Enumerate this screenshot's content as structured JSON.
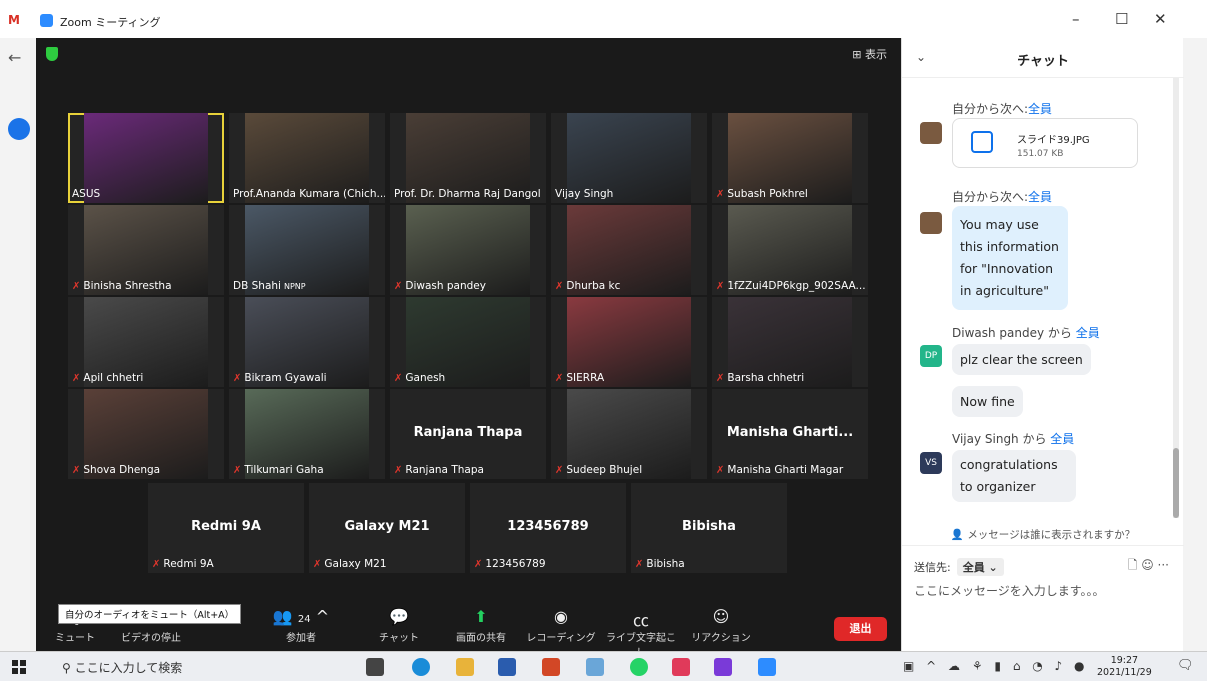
{
  "window": {
    "title": "Zoom ミーティング",
    "gmail": "M"
  },
  "video": {
    "view_label": "⊞ 表示",
    "participants": [
      {
        "name": "ASUS",
        "muted": false,
        "active": true,
        "bg": "#6b2a7a"
      },
      {
        "name": "Prof.Ananda Kumara (Chich...",
        "muted": false,
        "bg": "#5a4a3a"
      },
      {
        "name": "Prof. Dr. Dharma Raj Dangol",
        "muted": false,
        "bg": "#4a3e36"
      },
      {
        "name": "Vijay Singh",
        "muted": false,
        "bg": "#3a4450"
      },
      {
        "name": "Subash Pokhrel",
        "muted": true,
        "bg": "#6a5040"
      },
      {
        "name": "Binisha Shrestha",
        "muted": true,
        "bg": "#5b5248"
      },
      {
        "name": "DB Shahi",
        "sub": "NPNP",
        "muted": false,
        "bg": "#4b5866"
      },
      {
        "name": "Diwash pandey",
        "muted": true,
        "bg": "#5a6050"
      },
      {
        "name": "Dhurba kc",
        "muted": true,
        "bg": "#6b3a3a"
      },
      {
        "name": "1fZZui4DP6kgp_902SAA...",
        "muted": true,
        "bg": "#5a5a50"
      },
      {
        "name": "Apil chhetri",
        "muted": true,
        "bg": "#4a4a4a"
      },
      {
        "name": "Bikram Gyawali",
        "muted": true,
        "bg": "#4a4e58"
      },
      {
        "name": "Ganesh",
        "muted": true,
        "bg": "#2e3a30"
      },
      {
        "name": "SIERRA",
        "muted": true,
        "bg": "#8a3a40"
      },
      {
        "name": "Barsha chhetri",
        "muted": true,
        "bg": "#3a3238"
      },
      {
        "name": "Shova Dhenga",
        "muted": true,
        "bg": "#5a4038"
      },
      {
        "name": "Tilkumari Gaha",
        "muted": true,
        "bg": "#586a58"
      },
      {
        "name": "Ranjana Thapa",
        "muted": true,
        "big": "Ranjana Thapa"
      },
      {
        "name": "Sudeep Bhujel",
        "muted": true,
        "bg": "#4a4a4a"
      },
      {
        "name": "Manisha Gharti Magar",
        "muted": true,
        "big": "Manisha  Gharti..."
      },
      {
        "name": "Redmi 9A",
        "muted": true,
        "big": "Redmi 9A"
      },
      {
        "name": "Galaxy M21",
        "muted": true,
        "big": "Galaxy M21"
      },
      {
        "name": "123456789",
        "muted": true,
        "big": "123456789"
      },
      {
        "name": "Bibisha",
        "muted": true,
        "big": "Bibisha"
      }
    ]
  },
  "toolbar": {
    "tooltip": "自分のオーディオをミュート（Alt+A）",
    "mute": "ミュート",
    "video": "ビデオの停止",
    "participants": "参加者",
    "participants_count": "24",
    "chat": "チャット",
    "share": "画面の共有",
    "record": "レコーディング",
    "captions": "ライブ文字起こし",
    "reactions": "リアクション",
    "leave": "退出"
  },
  "chat": {
    "title": "チャット",
    "msg1_from": "自分から次へ:",
    "msg1_to": "全員",
    "file_name": "スライド39.JPG",
    "file_size": "151.07 KB",
    "msg2_from": "自分から次へ:",
    "msg2_to": "全員",
    "msg2_text": "You may use this information for \"Innovation in agriculture\"",
    "msg3_from": "Diwash pandey から ",
    "msg3_to": "全員",
    "msg3_avatar": "DP",
    "msg3_text1": "plz clear the screen",
    "msg3_text2": "Now fine",
    "msg4_from": "Vijay Singh から ",
    "msg4_to": "全員",
    "msg4_avatar": "VS",
    "msg4_text": "congratulations to organizer",
    "who_sees": "メッセージは誰に表示されますか？",
    "send_to_label": "送信先:",
    "send_to_value": "全員 ⌄",
    "input_placeholder": "ここにメッセージを入力します。。。"
  },
  "taskbar": {
    "search": "ここに入力して検索",
    "time": "19:27",
    "date": "2021/11/29"
  }
}
